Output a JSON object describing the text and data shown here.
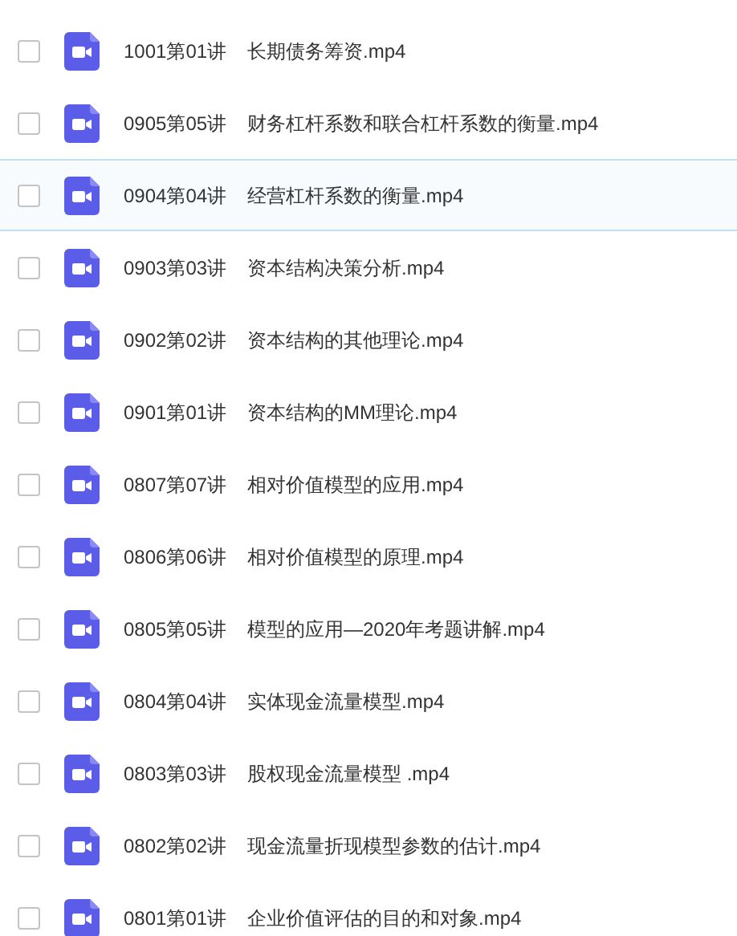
{
  "files": [
    {
      "code": "1001第01讲",
      "title": "长期债务筹资.mp4",
      "checked": false,
      "hovered": false
    },
    {
      "code": "0905第05讲",
      "title": "财务杠杆系数和联合杠杆系数的衡量.mp4",
      "checked": false,
      "hovered": false
    },
    {
      "code": "0904第04讲",
      "title": "经营杠杆系数的衡量.mp4",
      "checked": false,
      "hovered": true
    },
    {
      "code": "0903第03讲",
      "title": "资本结构决策分析.mp4",
      "checked": false,
      "hovered": false
    },
    {
      "code": "0902第02讲",
      "title": "资本结构的其他理论.mp4",
      "checked": false,
      "hovered": false
    },
    {
      "code": "0901第01讲",
      "title": "资本结构的MM理论.mp4",
      "checked": false,
      "hovered": false
    },
    {
      "code": "0807第07讲",
      "title": "相对价值模型的应用.mp4",
      "checked": false,
      "hovered": false
    },
    {
      "code": "0806第06讲",
      "title": "相对价值模型的原理.mp4",
      "checked": false,
      "hovered": false
    },
    {
      "code": "0805第05讲",
      "title": "模型的应用—2020年考题讲解.mp4",
      "checked": false,
      "hovered": false
    },
    {
      "code": "0804第04讲",
      "title": "实体现金流量模型.mp4",
      "checked": false,
      "hovered": false
    },
    {
      "code": "0803第03讲",
      "title": "股权现金流量模型 .mp4",
      "checked": false,
      "hovered": false
    },
    {
      "code": "0802第02讲",
      "title": "现金流量折现模型参数的估计.mp4",
      "checked": false,
      "hovered": false
    },
    {
      "code": "0801第01讲",
      "title": "企业价值评估的目的和对象.mp4",
      "checked": false,
      "hovered": false
    }
  ]
}
